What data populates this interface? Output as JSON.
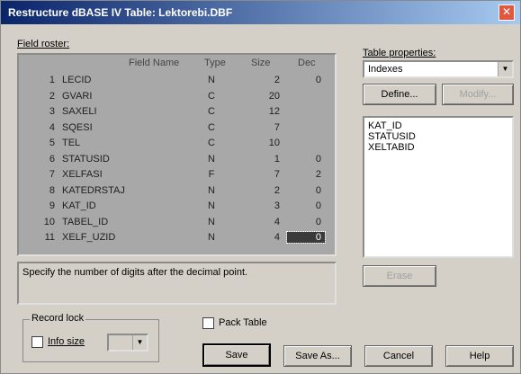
{
  "window": {
    "title": "Restructure dBASE IV Table: Lektorebi.DBF",
    "close_glyph": "✕"
  },
  "field_roster": {
    "label": "Field roster:",
    "headers": {
      "name": "Field Name",
      "type": "Type",
      "size": "Size",
      "dec": "Dec"
    },
    "rows": [
      {
        "num": "1",
        "name": "LECID",
        "type": "N",
        "size": "2",
        "dec": "0"
      },
      {
        "num": "2",
        "name": "GVARI",
        "type": "C",
        "size": "20",
        "dec": ""
      },
      {
        "num": "3",
        "name": "SAXELI",
        "type": "C",
        "size": "12",
        "dec": ""
      },
      {
        "num": "4",
        "name": "SQESI",
        "type": "C",
        "size": "7",
        "dec": ""
      },
      {
        "num": "5",
        "name": "TEL",
        "type": "C",
        "size": "10",
        "dec": ""
      },
      {
        "num": "6",
        "name": "STATUSID",
        "type": "N",
        "size": "1",
        "dec": "0"
      },
      {
        "num": "7",
        "name": "XELFASI",
        "type": "F",
        "size": "7",
        "dec": "2"
      },
      {
        "num": "8",
        "name": "KATEDRSTAJ",
        "type": "N",
        "size": "2",
        "dec": "0"
      },
      {
        "num": "9",
        "name": "KAT_ID",
        "type": "N",
        "size": "3",
        "dec": "0"
      },
      {
        "num": "10",
        "name": "TABEL_ID",
        "type": "N",
        "size": "4",
        "dec": "0"
      },
      {
        "num": "11",
        "name": "XELF_UZID",
        "type": "N",
        "size": "4",
        "dec": "0"
      }
    ]
  },
  "status_text": "Specify the number of digits after the decimal point.",
  "record_lock": {
    "label": "Record lock",
    "info_size_label": "Info size"
  },
  "pack_table": {
    "label": "Pack Table"
  },
  "table_properties": {
    "label": "Table properties:",
    "selected": "Indexes",
    "define_label": "Define...",
    "modify_label": "Modify...",
    "erase_label": "Erase",
    "items": [
      "KAT_ID",
      "STATUSID",
      "XELTABID"
    ]
  },
  "buttons": {
    "save": "Save",
    "save_as": "Save As...",
    "cancel": "Cancel",
    "help": "Help"
  }
}
